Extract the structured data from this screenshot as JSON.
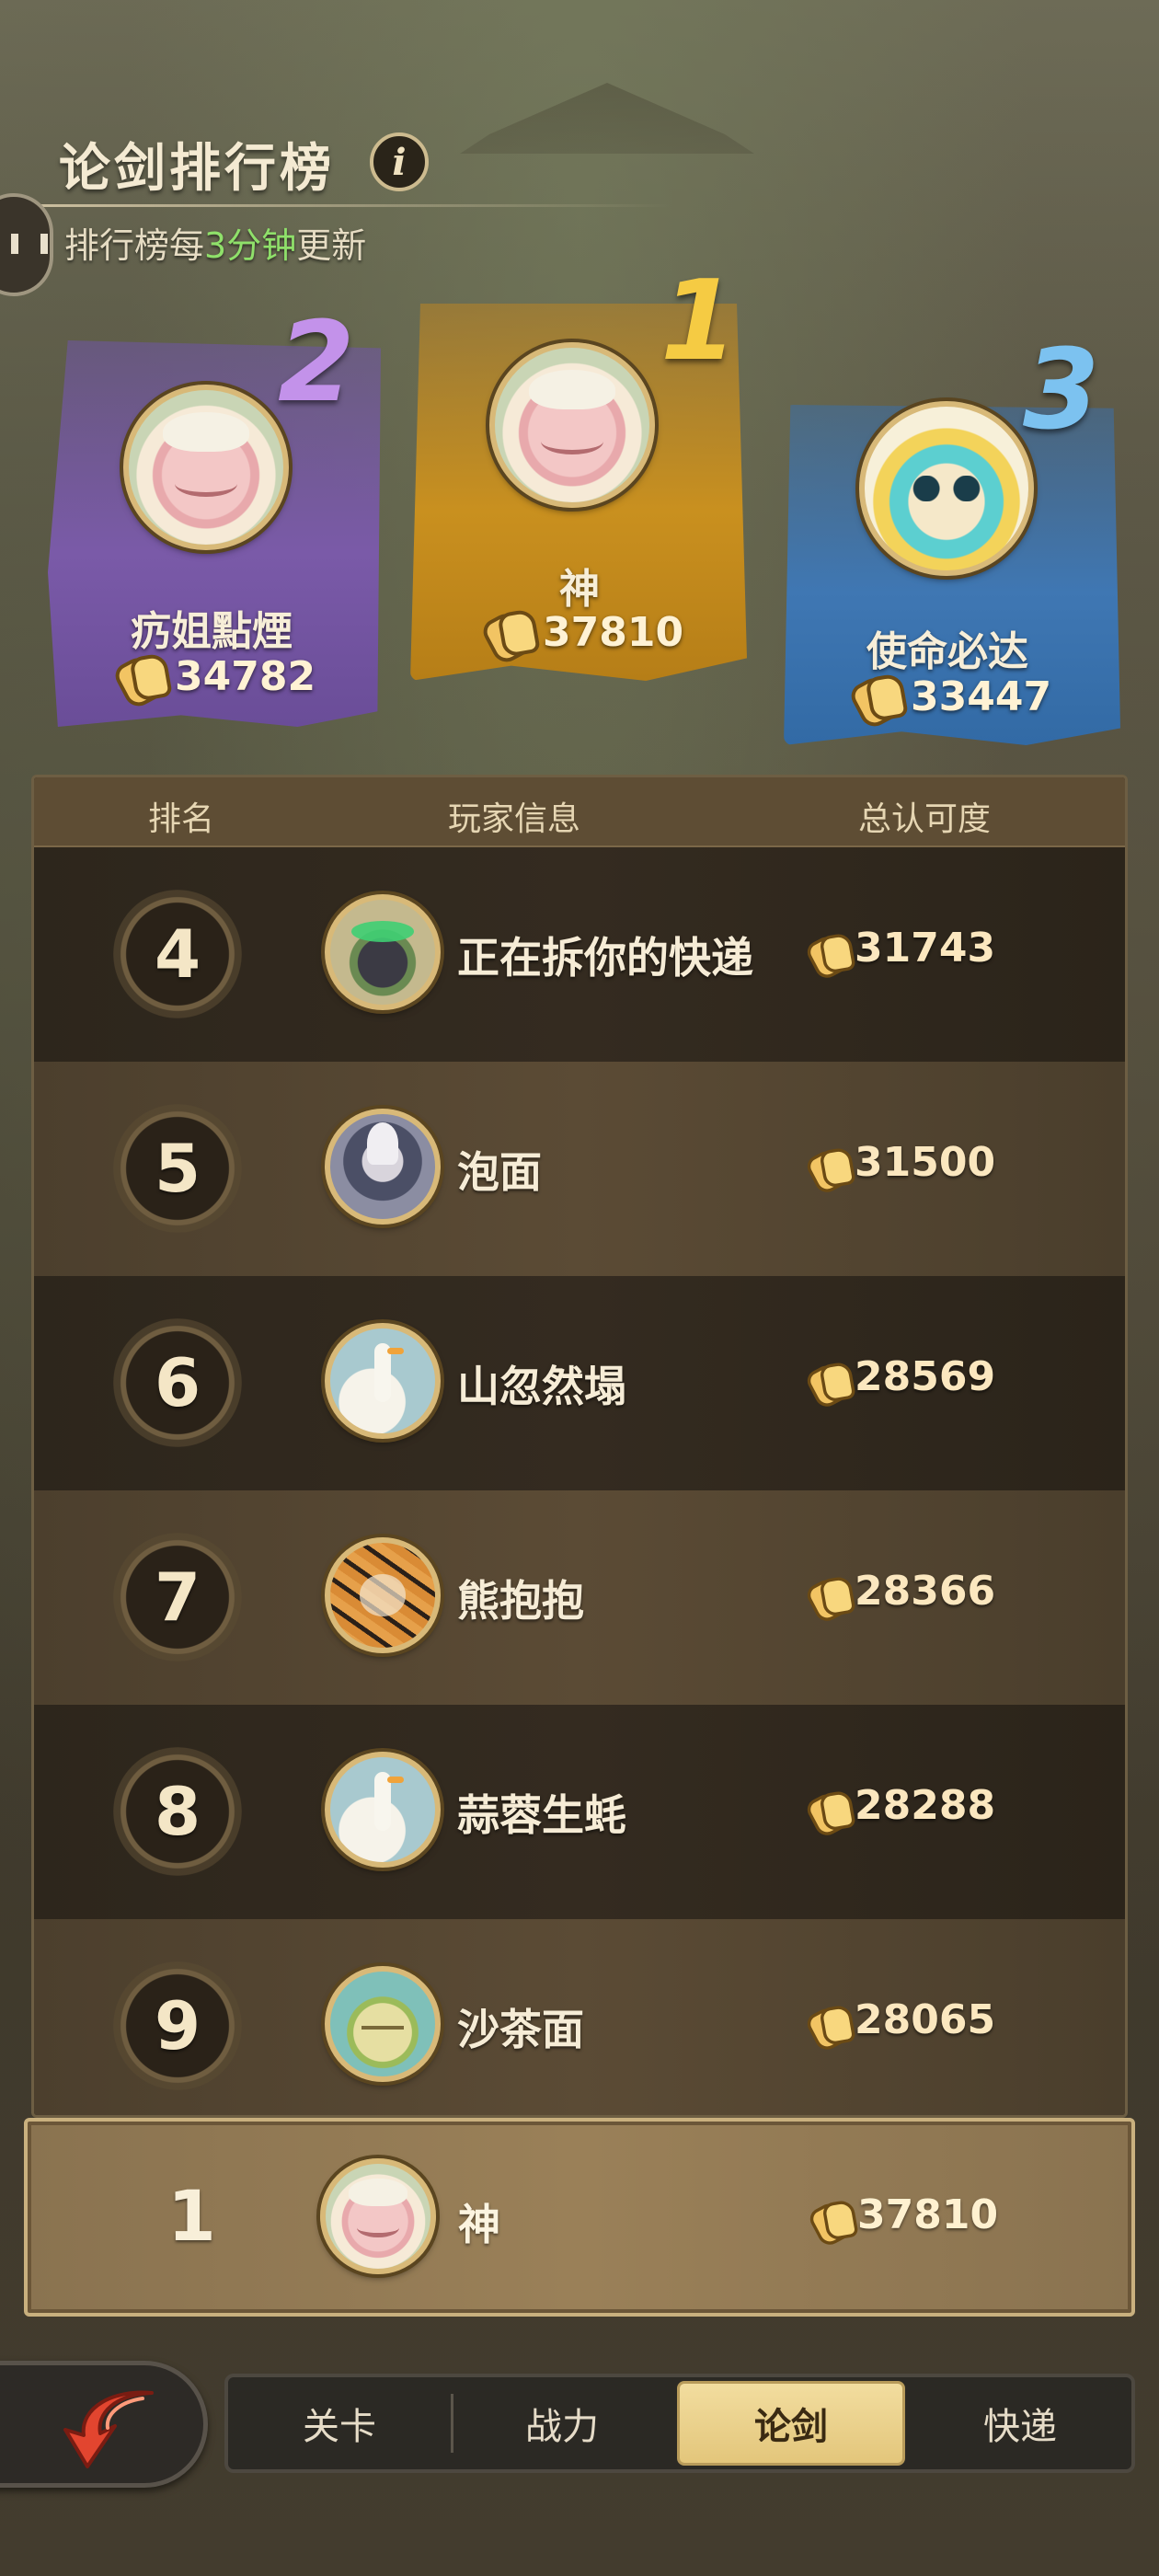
{
  "header": {
    "title": "论剑排行榜",
    "info_icon": "i",
    "subtitle_prefix": "排行榜每",
    "subtitle_highlight": "3分钟",
    "subtitle_suffix": "更新"
  },
  "podium": [
    {
      "rank": "1",
      "name": "神",
      "score": "37810",
      "avatar": "pig-avatar"
    },
    {
      "rank": "2",
      "name": "疓姐點煙",
      "score": "34782",
      "avatar": "pig-avatar"
    },
    {
      "rank": "3",
      "name": "使命必达",
      "score": "33447",
      "avatar": "bird-avatar"
    }
  ],
  "table": {
    "headers": {
      "rank": "排名",
      "player": "玩家信息",
      "score": "总认可度"
    },
    "rows": [
      {
        "rank": "4",
        "name": "正在拆你的快递",
        "score": "31743",
        "avatar": "hat-avatar"
      },
      {
        "rank": "5",
        "name": "泡面",
        "score": "31500",
        "avatar": "ninja-avatar"
      },
      {
        "rank": "6",
        "name": "山忽然塌",
        "score": "28569",
        "avatar": "goose-avatar"
      },
      {
        "rank": "7",
        "name": "熊抱抱",
        "score": "28366",
        "avatar": "tiger-avatar"
      },
      {
        "rank": "8",
        "name": "蒜蓉生蚝",
        "score": "28288",
        "avatar": "goose-avatar"
      },
      {
        "rank": "9",
        "name": "沙茶面",
        "score": "28065",
        "avatar": "melon-avatar"
      }
    ]
  },
  "self": {
    "rank": "1",
    "name": "神",
    "score": "37810",
    "avatar": "pig-avatar"
  },
  "tabs": [
    {
      "label": "关卡",
      "active": false
    },
    {
      "label": "战力",
      "active": false
    },
    {
      "label": "论剑",
      "active": true
    },
    {
      "label": "快递",
      "active": false
    }
  ],
  "icons": {
    "score": "clap-icon",
    "back": "back-arrow-icon",
    "side": "pause-handle-icon"
  },
  "colors": {
    "rank1": "#f5cb43",
    "rank2": "#c392ea",
    "rank3": "#7cc2f0",
    "subtitle_highlight": "#8fe06a",
    "active_tab": "#f2dd9f"
  }
}
